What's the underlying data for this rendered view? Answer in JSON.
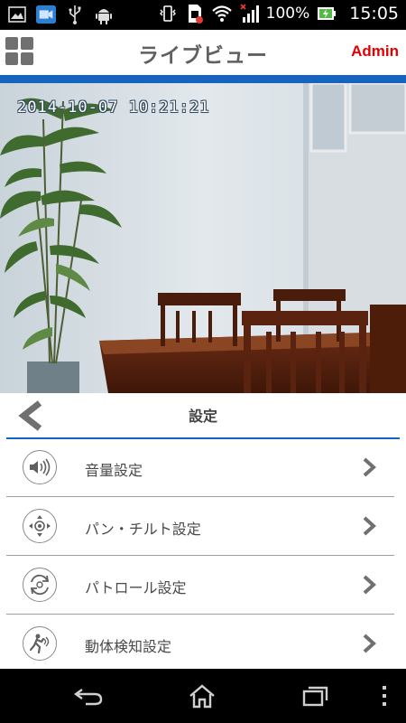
{
  "status_bar": {
    "battery": "100%",
    "time": "15:05"
  },
  "header": {
    "title": "ライブビュー",
    "admin_label": "Admin"
  },
  "video": {
    "timestamp": "2014-10-07 10:21:21"
  },
  "settings": {
    "title": "設定",
    "items": [
      {
        "label": "音量設定",
        "icon": "speaker-icon"
      },
      {
        "label": "パン・チルト設定",
        "icon": "pan-tilt-icon"
      },
      {
        "label": "パトロール設定",
        "icon": "patrol-icon"
      },
      {
        "label": "動体検知設定",
        "icon": "motion-detection-icon"
      }
    ]
  },
  "colors": {
    "accent_blue": "#1565c0",
    "admin_red": "#e30000"
  }
}
